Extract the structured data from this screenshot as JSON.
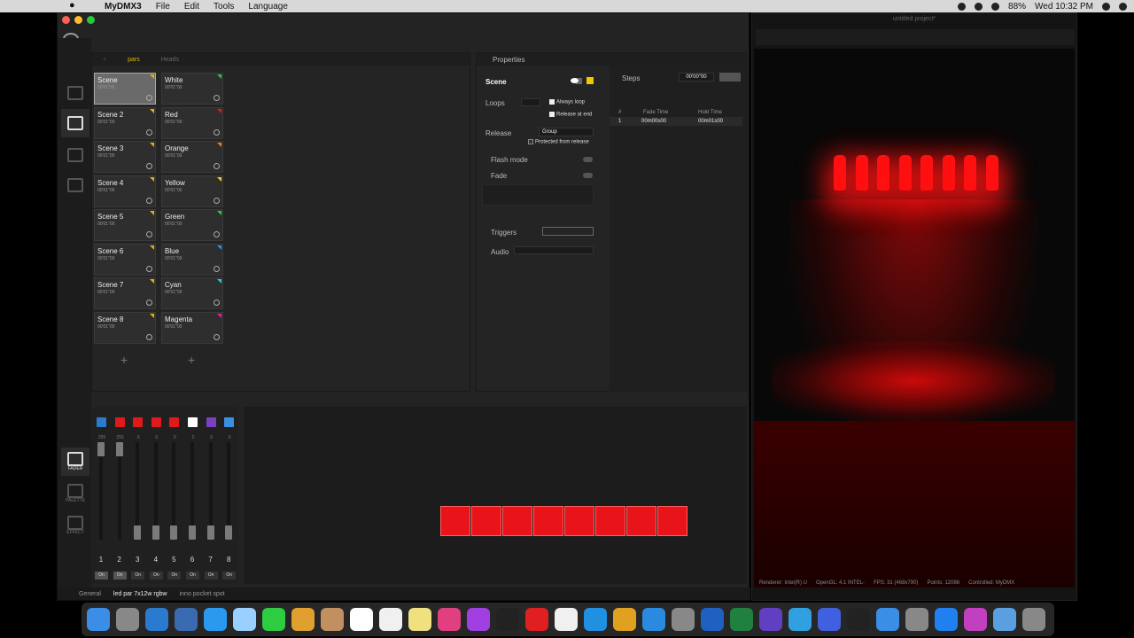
{
  "menubar": {
    "app": "MyDMX3",
    "menus": [
      "File",
      "Edit",
      "Tools",
      "Language"
    ],
    "battery": "88%",
    "clock": "Wed 10:32 PM"
  },
  "scenes_panel": {
    "tabs": [
      "pars",
      "Heads"
    ],
    "active_tab": "pars",
    "left_column": [
      {
        "name": "Scene",
        "time": "00'01\"00",
        "flag": "#e2b400"
      },
      {
        "name": "Scene 2",
        "time": "00'01\"00",
        "flag": "#e2b400"
      },
      {
        "name": "Scene 3",
        "time": "00'01\"00",
        "flag": "#e2b400"
      },
      {
        "name": "Scene 4",
        "time": "00'01\"00",
        "flag": "#e2b400"
      },
      {
        "name": "Scene 5",
        "time": "00'01\"00",
        "flag": "#e2b400"
      },
      {
        "name": "Scene 6",
        "time": "00'01\"00",
        "flag": "#e2b400"
      },
      {
        "name": "Scene 7",
        "time": "00'01\"00",
        "flag": "#e2b400"
      },
      {
        "name": "Scene 8",
        "time": "00'01\"00",
        "flag": "#e2b400"
      }
    ],
    "right_column": [
      {
        "name": "White",
        "time": "00'01\"00",
        "flag": "#2ecc40"
      },
      {
        "name": "Red",
        "time": "00'01\"00",
        "flag": "#e01a1a"
      },
      {
        "name": "Orange",
        "time": "00'01\"00",
        "flag": "#f08020"
      },
      {
        "name": "Yellow",
        "time": "00'01\"00",
        "flag": "#f0d020"
      },
      {
        "name": "Green",
        "time": "00'01\"00",
        "flag": "#2ecc40"
      },
      {
        "name": "Blue",
        "time": "00'01\"00",
        "flag": "#20a0e0"
      },
      {
        "name": "Cyan",
        "time": "00'01\"00",
        "flag": "#20d0d0"
      },
      {
        "name": "Magenta",
        "time": "00'01\"00",
        "flag": "#e020a0"
      }
    ],
    "add_symbol": "+"
  },
  "properties": {
    "header": "Properties",
    "scene_name": "Scene",
    "loops_label": "Loops",
    "always_loop": "Always loop",
    "release_at_end": "Release at end",
    "release_label": "Release",
    "release_value": "Group",
    "protected": "Protected from release",
    "flash_mode": "Flash mode",
    "fade": "Fade",
    "triggers": "Triggers",
    "audio": "Audio",
    "steps_label": "Steps",
    "steps_time": "00'00\"00",
    "col_num": "#",
    "col_fade": "Fade Time",
    "col_hold": "Hold Time",
    "step_row": {
      "num": "1",
      "fade": "00m00s00",
      "hold": "00m01s00"
    }
  },
  "faders": {
    "swatches": [
      "#2a7ad0",
      "#e01a1a",
      "#e01a1a",
      "#e01a1a",
      "#e01a1a",
      "#ffffff",
      "#7a40c0",
      "#3a90e0"
    ],
    "numbers": [
      "1",
      "2",
      "3",
      "4",
      "5",
      "6",
      "7",
      "8"
    ],
    "values": [
      "255",
      "255",
      "0",
      "0",
      "0",
      "0",
      "0",
      "0"
    ],
    "levels": [
      1.0,
      1.0,
      0,
      0,
      0,
      0,
      0,
      0
    ],
    "on_label": "On",
    "left_labels": [
      "FADER",
      "PALETTE",
      "EFFECT"
    ]
  },
  "fixtures_count_label": "8",
  "statusbar": {
    "items": [
      "General",
      "led par 7x12w rgbw",
      "inno pocket spot"
    ]
  },
  "win3d": {
    "title": "untitled project*",
    "renderer": "Renderer: Intel(R) U",
    "opengl": "OpenGL: 4.1 INTEL-",
    "fps": "FPS: 31 (468x790)",
    "points": "Points: 12086",
    "controlled": "Controlled: MyDMX"
  }
}
